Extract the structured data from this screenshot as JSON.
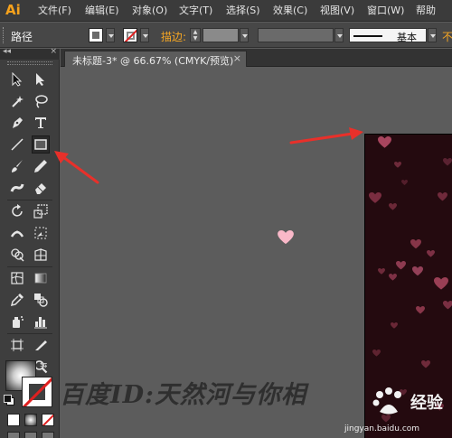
{
  "app": {
    "logo": "Ai"
  },
  "menu": [
    "文件(F)",
    "编辑(E)",
    "对象(O)",
    "文字(T)",
    "选择(S)",
    "效果(C)",
    "视图(V)",
    "窗口(W)",
    "帮助"
  ],
  "control_bar": {
    "selection_type": "路径",
    "stroke_label": "描边:",
    "brush_style": "基本",
    "opacity_label": "不"
  },
  "toolbox": {
    "collapse": "◂◂",
    "close": "×",
    "tools": [
      "selection-tool",
      "direct-selection-tool",
      "magic-wand-tool",
      "lasso-tool",
      "pen-tool",
      "type-tool",
      "line-segment-tool",
      "rectangle-tool",
      "paintbrush-tool",
      "pencil-tool",
      "blob-brush-tool",
      "eraser-tool",
      "rotate-tool",
      "scale-tool",
      "width-tool",
      "free-transform-tool",
      "shape-builder-tool",
      "perspective-grid-tool",
      "mesh-tool",
      "gradient-tool",
      "eyedropper-tool",
      "blend-tool",
      "symbol-sprayer-tool",
      "column-graph-tool",
      "artboard-tool",
      "slice-tool",
      "hand-tool",
      "zoom-tool"
    ]
  },
  "document": {
    "tab_title": "未标题-3* @ 66.67% (CMYK/预览)",
    "close": "×"
  },
  "colors": {
    "artboard_bg": "#240a0f",
    "heart": "#9a3f55",
    "heart_selected": "#f9b8c8",
    "arrow": "#e8302a",
    "accent_label": "#f5a623"
  },
  "watermark": {
    "text": "百度ID:天然河与你相",
    "logo": "经验",
    "url": "jingyan.baidu.com"
  }
}
